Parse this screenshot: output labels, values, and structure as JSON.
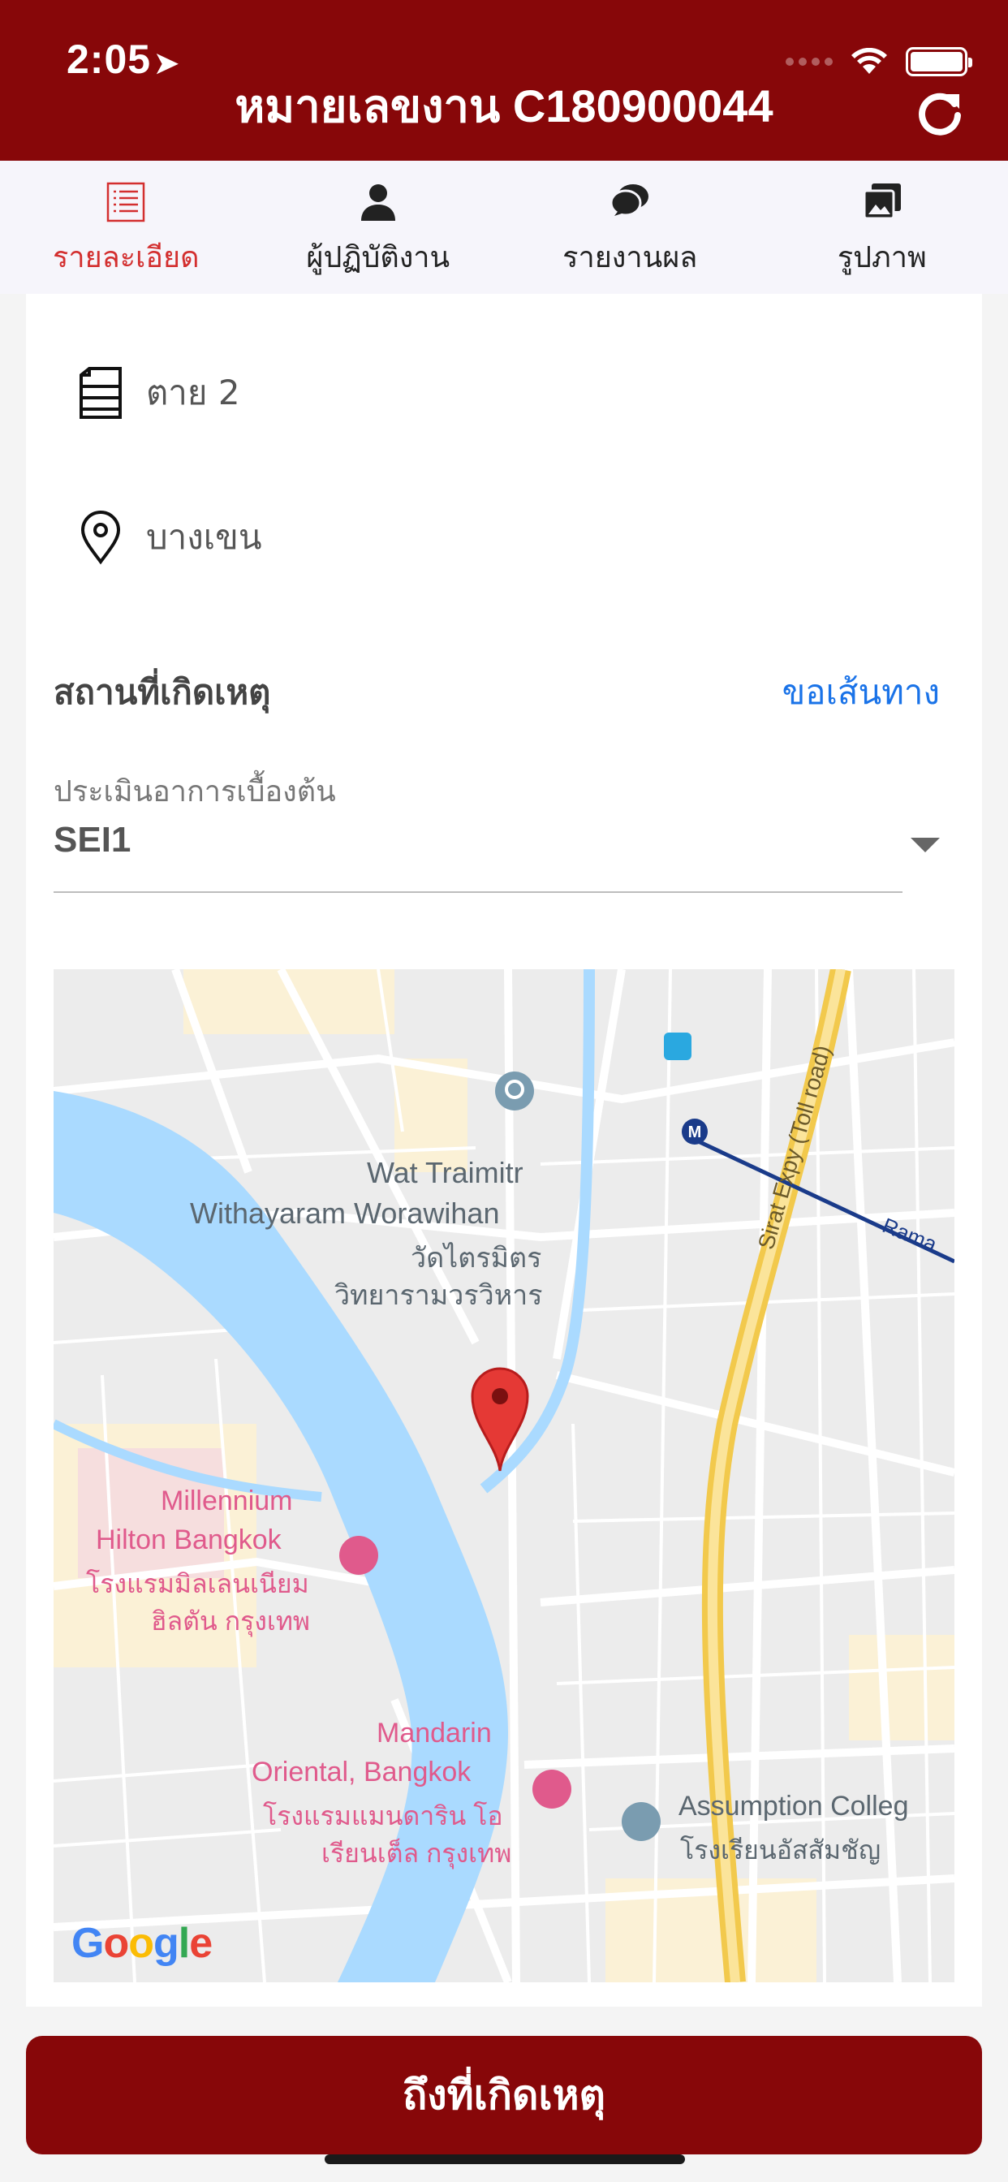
{
  "status": {
    "time": "2:05"
  },
  "header": {
    "title": "หมายเลขงาน C180900044"
  },
  "tabs": [
    {
      "label": "รายละเอียด",
      "icon": "list-icon",
      "active": true
    },
    {
      "label": "ผู้ปฏิบัติงาน",
      "icon": "person-icon",
      "active": false
    },
    {
      "label": "รายงานผล",
      "icon": "chat-bubble-icon",
      "active": false
    },
    {
      "label": "รูปภาพ",
      "icon": "photos-icon",
      "active": false
    }
  ],
  "details": {
    "case_type": "ตาย 2",
    "district": "บางเขน"
  },
  "location_section": {
    "title": "สถานที่เกิดเหตุ",
    "directions_label": "ขอเส้นทาง"
  },
  "assessment": {
    "label": "ประเมินอาการเบื้องต้น",
    "value": "SEI1"
  },
  "map": {
    "labels": {
      "wat_en_1": "Wat Traimitr",
      "wat_en_2": "Withayaram Worawihan",
      "wat_th_1": "วัดไตรมิตร",
      "wat_th_2": "วิทยารามวรวิหาร",
      "hilton_en_1": "Millennium",
      "hilton_en_2": "Hilton Bangkok",
      "hilton_th_1": "โรงแรมมิลเลนเนียม",
      "hilton_th_2": "ฮิลตัน กรุงเทพ",
      "mandarin_en_1": "Mandarin",
      "mandarin_en_2": "Oriental, Bangkok",
      "mandarin_th_1": "โรงแรมแมนดาริน โอ",
      "mandarin_th_2": "เรียนเต็ล กรุงเทพ",
      "assumption_en": "Assumption Colleg",
      "assumption_th": "โรงเรียนอัสสัมชัญ",
      "expressway": "Sirat Expy (Toll road)",
      "rama": "Rama",
      "google": "Google"
    }
  },
  "footer": {
    "button_label": "ถึงที่เกิดเหตุ"
  },
  "colors": {
    "brand": "#870709",
    "active_tab": "#d32f2f",
    "link": "#1a73e8",
    "river": "#aadaff"
  }
}
